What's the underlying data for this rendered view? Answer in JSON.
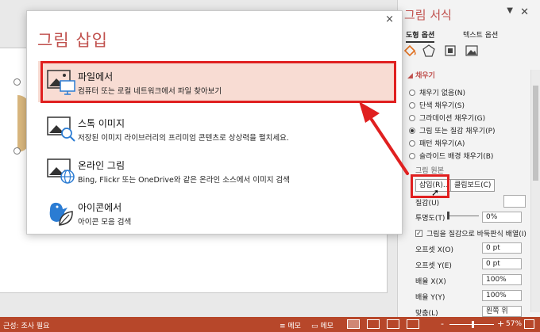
{
  "dialog": {
    "title": "그림 삽입",
    "close_label": "×",
    "options": [
      {
        "title": "파일에서",
        "description": "컴퓨터 또는 로컬 네트워크에서 파일 찾아보기",
        "icon": "picture-monitor-icon"
      },
      {
        "title": "스톡 이미지",
        "description": "저장된 이미지 라이브러리의 프리미엄 콘텐츠로 상상력을 펼치세요.",
        "icon": "picture-search-icon"
      },
      {
        "title": "온라인 그림",
        "description": "Bing, Flickr 또는 OneDrive와 같은 온라인 소스에서 이미지 검색",
        "icon": "picture-globe-icon"
      },
      {
        "title": "아이콘에서",
        "description": "아이콘 모음 검색",
        "icon": "bird-leaf-icon"
      }
    ]
  },
  "pane": {
    "title": "그림 서식",
    "tab_shape": "도형 옵션",
    "tab_text": "텍스트 옵션",
    "fill_section": "채우기",
    "fill_options": [
      {
        "label": "채우기 없음(N)",
        "selected": false
      },
      {
        "label": "단색 채우기(S)",
        "selected": false
      },
      {
        "label": "그라데이션 채우기(G)",
        "selected": false
      },
      {
        "label": "그림 또는 질감 채우기(P)",
        "selected": true
      },
      {
        "label": "패턴 채우기(A)",
        "selected": false
      },
      {
        "label": "슬라이드 배경 채우기(B)",
        "selected": false
      }
    ],
    "source_label": "그림 원본",
    "insert_button": "삽입(R)...",
    "clipboard_button": "클립보드(C)",
    "texture_label": "질감(U)",
    "transparency_label": "투명도(T)",
    "transparency_value": "0%",
    "tile_checkbox": "그림을 질감으로 바둑판식 배열(I)",
    "tile_checked": true,
    "offset_x_label": "오프셋 X(O)",
    "offset_x_value": "0 pt",
    "offset_y_label": "오프셋 Y(E)",
    "offset_y_value": "0 pt",
    "scale_x_label": "배율 X(X)",
    "scale_x_value": "100%",
    "scale_y_label": "배율 Y(Y)",
    "scale_y_value": "100%",
    "align_label": "맞춤(L)",
    "align_value": "왼쪽 위"
  },
  "status": {
    "accessibility": "근성: 조사 필요",
    "notes": "메모",
    "comments": "메모",
    "zoom": "57%",
    "zoom_minus": "-",
    "zoom_plus": "+"
  },
  "colors": {
    "accent": "#c0504d",
    "status_bar": "#b7472a",
    "highlight": "#e02020",
    "hover": "#f8dcd3"
  }
}
